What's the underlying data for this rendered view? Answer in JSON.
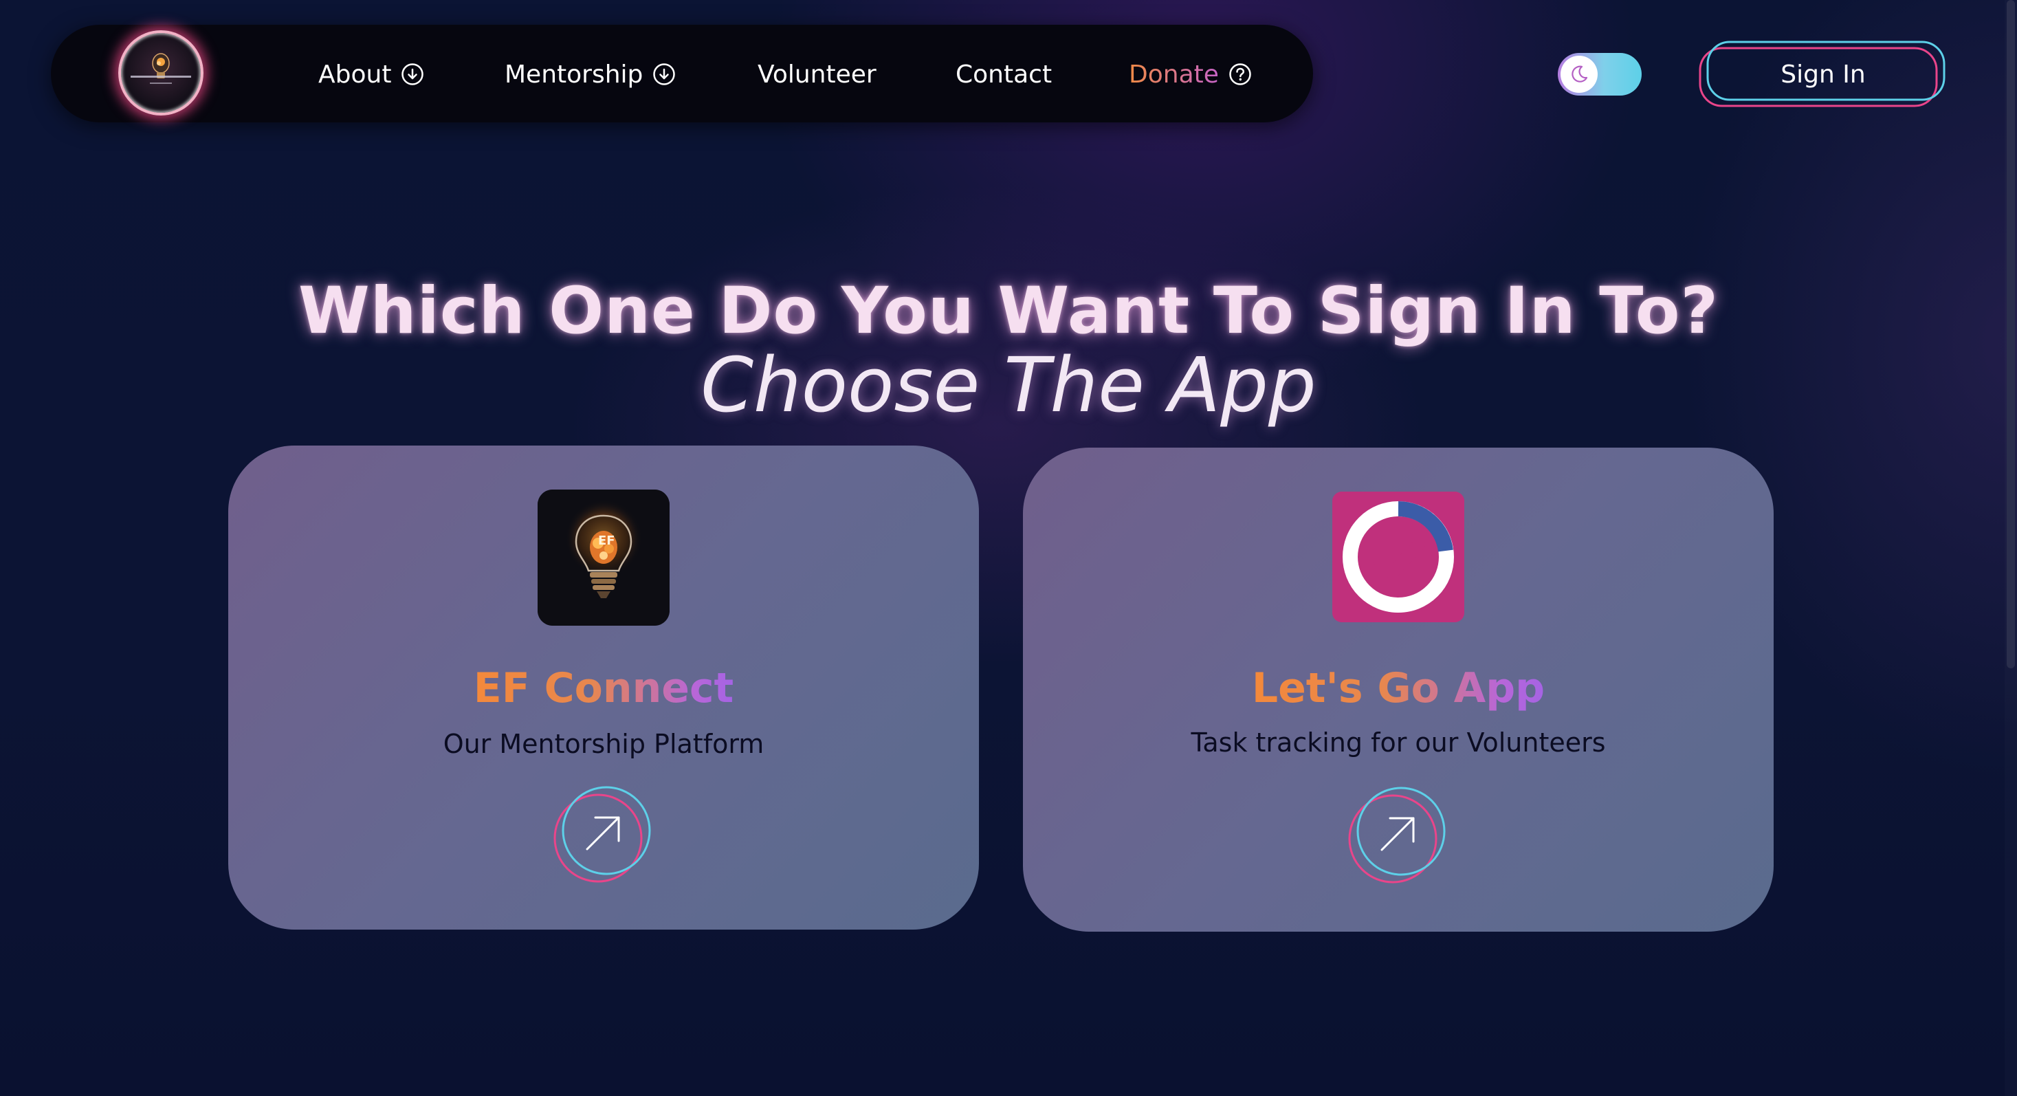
{
  "nav": {
    "logo_icon": "empowered-futures-logo",
    "items": [
      {
        "label": "About",
        "icon": "chevron-down-circle-icon"
      },
      {
        "label": "Mentorship",
        "icon": "chevron-down-circle-icon"
      },
      {
        "label": "Volunteer"
      },
      {
        "label": "Contact"
      },
      {
        "label": "Donate",
        "icon": "question-circle-icon"
      }
    ],
    "theme_toggle": {
      "icon": "moon-icon",
      "state": "dark"
    },
    "sign_in_label": "Sign In"
  },
  "hero": {
    "title": "Which One Do You Want To Sign In To?",
    "subtitle": "Choose The App"
  },
  "apps": [
    {
      "name": "EF Connect",
      "description": "Our Mentorship Platform",
      "icon": "lightbulb-app-icon"
    },
    {
      "name": "Let's Go App",
      "description": "Task tracking for our Volunteers",
      "icon": "checkmark-progress-app-icon"
    }
  ],
  "colors": {
    "background": "#0b1434",
    "nav_background": "#06060f",
    "accent_pink": "#e9458a",
    "accent_cyan": "#5dd0e8",
    "title_orange": "#f4893b",
    "title_purple": "#a564e4",
    "card": "#656891",
    "letsgo_icon_bg": "#c0307c"
  }
}
